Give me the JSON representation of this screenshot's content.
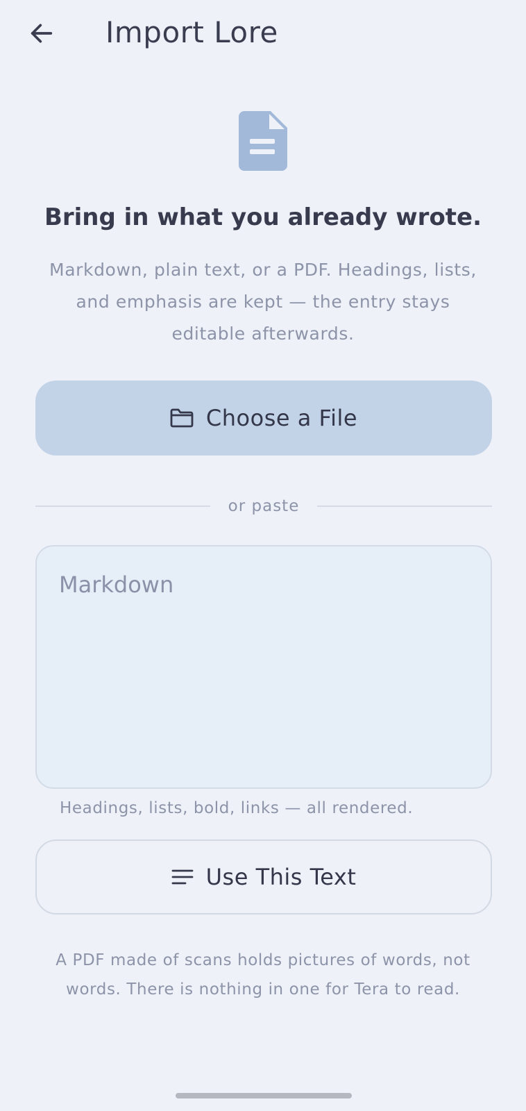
{
  "app_bar": {
    "back_icon": "arrow-left-icon",
    "title": "Import Lore"
  },
  "hero": {
    "icon": "document-icon",
    "icon_color": "#a3b9d9",
    "headline": "Bring in what you already wrote.",
    "subtext": "Markdown, plain text, or a PDF. Headings, lists, and emphasis are kept — the entry stays editable afterwards."
  },
  "choose_file": {
    "icon": "folder-icon",
    "label": "Choose a File",
    "background": "#c2d3e7"
  },
  "divider": {
    "label": "or paste"
  },
  "paste_input": {
    "placeholder": "Markdown",
    "value": ""
  },
  "helper_text": "Headings, lists, bold, links — all rendered.",
  "use_text": {
    "icon": "lines-icon",
    "label": "Use This Text"
  },
  "footnote": "A PDF made of scans holds pictures of words, not words. There is nothing in one for Tera to read.",
  "colors": {
    "background": "#eef2f8",
    "text_primary": "#3a3d50",
    "text_secondary": "#8d93a8"
  }
}
